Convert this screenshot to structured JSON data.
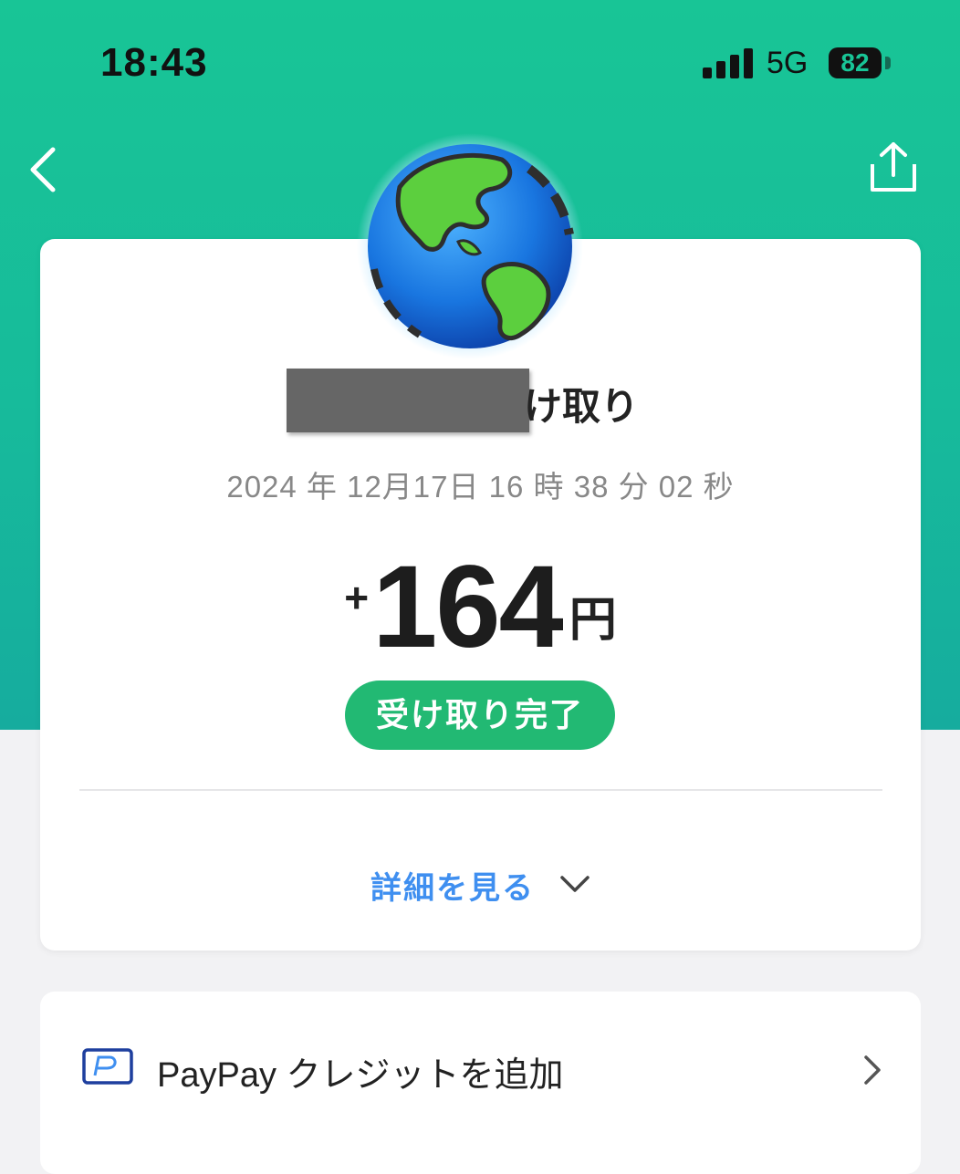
{
  "status_bar": {
    "time": "18:43",
    "network": "5G",
    "battery": "82"
  },
  "nav": {
    "back_icon": "chevron-left-icon",
    "share_icon": "share-icon"
  },
  "transaction": {
    "avatar_icon": "globe-americas-icon",
    "title_suffix": "け取り",
    "datetime": "2024 年 12月17日 16 時 38 分 02 秒",
    "amount_sign": "+",
    "amount_value": "164",
    "amount_unit": "円",
    "status_label": "受け取り完了",
    "details_label": "詳細を見る"
  },
  "credit": {
    "label": "PayPay クレジットを追加",
    "icon": "paypay-card-icon"
  },
  "colors": {
    "header_green": "#18c596",
    "status_green": "#22b973",
    "link_blue": "#3f8ff0"
  }
}
